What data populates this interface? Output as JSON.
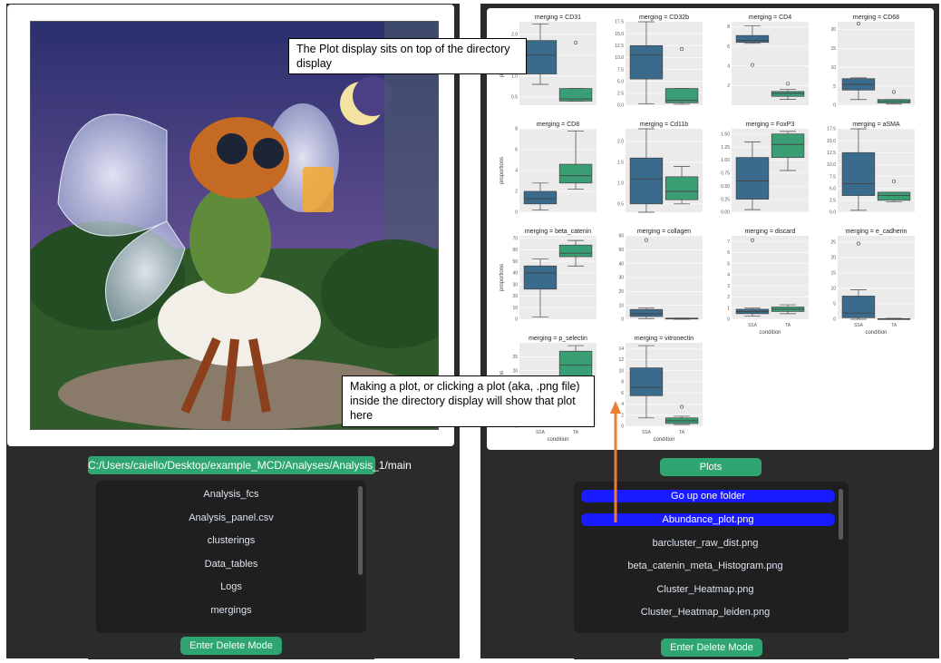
{
  "left": {
    "path_button": "C:/Users/caiello/Desktop/example_MCD/Analyses/Analysis_1/main",
    "files": [
      "Analysis_fcs",
      "Analysis_panel.csv",
      "clusterings",
      "Data_tables",
      "Logs",
      "mergings"
    ],
    "delete_button": "Enter Delete Mode"
  },
  "right": {
    "plots_button": "Plots",
    "files": [
      "Go up one folder",
      "Abundance_plot.png",
      "barcluster_raw_dist.png",
      "beta_catenin_meta_Histogram.png",
      "Cluster_Heatmap.png",
      "Cluster_Heatmap_leiden.png"
    ],
    "highlighted": [
      "Go up one folder",
      "Abundance_plot.png"
    ],
    "delete_button": "Enter Delete Mode"
  },
  "callouts": {
    "top": "The Plot display sits on top of the directory display",
    "bottom": "Making a plot, or clicking a plot (aka, .png file) inside the directory display will show that plot here"
  },
  "colors": {
    "green": "#2fa572",
    "ssa": "#3a6b8c",
    "ta": "#3a9e74",
    "highlight": "#1a1aff",
    "arrow": "#ed7d31"
  },
  "chart_data": {
    "type": "box",
    "x_label": "condition",
    "y_label": "proportions",
    "categories": [
      "SSA",
      "TA"
    ],
    "facet_title_prefix": "merging = ",
    "facets": [
      {
        "name": "CD31",
        "yticks": [
          "0.5",
          "1.0",
          "1.5",
          "2.0"
        ],
        "ymin": 0.3,
        "ymax": 2.3,
        "boxes": [
          {
            "q1": 1.05,
            "med": 1.5,
            "q3": 1.85,
            "lo": 0.8,
            "hi": 2.25,
            "out": []
          },
          {
            "q1": 0.4,
            "med": 0.45,
            "q3": 0.7,
            "lo": 0.4,
            "hi": 0.7,
            "out": [
              1.8
            ]
          }
        ]
      },
      {
        "name": "CD32b",
        "yticks": [
          "0.0",
          "2.5",
          "5.0",
          "7.5",
          "10.0",
          "12.5",
          "15.0",
          "17.5"
        ],
        "ymin": 0,
        "ymax": 17.5,
        "boxes": [
          {
            "q1": 5.5,
            "med": 10.5,
            "q3": 12.5,
            "lo": 0.3,
            "hi": 17.5,
            "out": []
          },
          {
            "q1": 0.5,
            "med": 1.0,
            "q3": 3.5,
            "lo": 0.2,
            "hi": 3.5,
            "out": [
              11.8
            ]
          }
        ]
      },
      {
        "name": "CD4",
        "yticks": [
          "2",
          "4",
          "6",
          "8"
        ],
        "ymin": 0,
        "ymax": 8.5,
        "boxes": [
          {
            "q1": 6.4,
            "med": 6.6,
            "q3": 7.1,
            "lo": 6.3,
            "hi": 8.1,
            "out": [
              4.1
            ]
          },
          {
            "q1": 0.9,
            "med": 1.2,
            "q3": 1.4,
            "lo": 0.6,
            "hi": 1.6,
            "out": [
              2.2
            ]
          }
        ]
      },
      {
        "name": "CD68",
        "yticks": [
          "0",
          "5",
          "10",
          "15",
          "20"
        ],
        "ymin": 0,
        "ymax": 22,
        "boxes": [
          {
            "q1": 4.0,
            "med": 5.5,
            "q3": 7.0,
            "lo": 1.5,
            "hi": 7.2,
            "out": [
              21.5
            ]
          },
          {
            "q1": 0.6,
            "med": 1.0,
            "q3": 1.5,
            "lo": 0.3,
            "hi": 1.5,
            "out": [
              3.5
            ]
          }
        ]
      },
      {
        "name": "CD8",
        "yticks": [
          "0",
          "2",
          "4",
          "6",
          "8"
        ],
        "ymin": 0,
        "ymax": 8,
        "boxes": [
          {
            "q1": 0.8,
            "med": 1.3,
            "q3": 2.0,
            "lo": 0.2,
            "hi": 2.8,
            "out": []
          },
          {
            "q1": 2.8,
            "med": 3.5,
            "q3": 4.6,
            "lo": 2.2,
            "hi": 7.8,
            "out": []
          }
        ]
      },
      {
        "name": "Cd11b",
        "yticks": [
          "0.5",
          "1.0",
          "1.5",
          "2.0"
        ],
        "ymin": 0.3,
        "ymax": 2.3,
        "boxes": [
          {
            "q1": 0.5,
            "med": 1.1,
            "q3": 1.6,
            "lo": 0.3,
            "hi": 2.3,
            "out": []
          },
          {
            "q1": 0.6,
            "med": 0.8,
            "q3": 1.15,
            "lo": 0.5,
            "hi": 1.4,
            "out": []
          }
        ]
      },
      {
        "name": "FoxP3",
        "yticks": [
          "0.00",
          "0.25",
          "0.50",
          "0.75",
          "1.00",
          "1.25",
          "1.50"
        ],
        "ymin": 0,
        "ymax": 1.6,
        "boxes": [
          {
            "q1": 0.25,
            "med": 0.6,
            "q3": 1.05,
            "lo": 0.05,
            "hi": 1.35,
            "out": []
          },
          {
            "q1": 1.05,
            "med": 1.3,
            "q3": 1.5,
            "lo": 0.8,
            "hi": 1.55,
            "out": []
          }
        ]
      },
      {
        "name": "aSMA",
        "yticks": [
          "0.0",
          "2.5",
          "5.0",
          "7.5",
          "10.0",
          "12.5",
          "15.0",
          "17.5"
        ],
        "ymin": 0,
        "ymax": 17.5,
        "boxes": [
          {
            "q1": 3.5,
            "med": 6.0,
            "q3": 12.5,
            "lo": 0.4,
            "hi": 17.5,
            "out": []
          },
          {
            "q1": 2.5,
            "med": 3.5,
            "q3": 4.2,
            "lo": 2.2,
            "hi": 4.2,
            "out": [
              6.5
            ]
          }
        ]
      },
      {
        "name": "beta_catenin",
        "yticks": [
          "0",
          "10",
          "20",
          "30",
          "40",
          "50",
          "60",
          "70"
        ],
        "ymin": 0,
        "ymax": 72,
        "boxes": [
          {
            "q1": 26,
            "med": 40,
            "q3": 46,
            "lo": 2,
            "hi": 52,
            "out": []
          },
          {
            "q1": 54,
            "med": 57,
            "q3": 64,
            "lo": 46,
            "hi": 68,
            "out": []
          }
        ]
      },
      {
        "name": "collagen",
        "yticks": [
          "0",
          "10",
          "20",
          "30",
          "40",
          "50",
          "60"
        ],
        "ymin": 0,
        "ymax": 60,
        "boxes": [
          {
            "q1": 2,
            "med": 4,
            "q3": 7,
            "lo": 0.5,
            "hi": 8,
            "out": [
              57
            ]
          },
          {
            "q1": 0.2,
            "med": 0.5,
            "q3": 0.8,
            "lo": 0,
            "hi": 0.8,
            "out": []
          }
        ]
      },
      {
        "name": "discard",
        "yticks": [
          "0",
          "1",
          "2",
          "3",
          "4",
          "5",
          "6",
          "7"
        ],
        "ymin": 0,
        "ymax": 7.5,
        "boxes": [
          {
            "q1": 0.5,
            "med": 0.7,
            "q3": 0.9,
            "lo": 0.3,
            "hi": 1.0,
            "out": [
              7.1
            ]
          },
          {
            "q1": 0.7,
            "med": 0.9,
            "q3": 1.1,
            "lo": 0.5,
            "hi": 1.3,
            "out": []
          }
        ]
      },
      {
        "name": "e_cadherin",
        "yticks": [
          "0",
          "5",
          "10",
          "15",
          "20",
          "25"
        ],
        "ymin": 0,
        "ymax": 27,
        "boxes": [
          {
            "q1": 0.5,
            "med": 2.0,
            "q3": 7.5,
            "lo": 0,
            "hi": 9.5,
            "out": [
              24.5
            ]
          },
          {
            "q1": 0.05,
            "med": 0.1,
            "q3": 0.2,
            "lo": 0,
            "hi": 0.3,
            "out": []
          }
        ]
      },
      {
        "name": "p_selectin",
        "yticks": [
          "0",
          "5",
          "10",
          "15",
          "20",
          "25"
        ],
        "ymin": 0,
        "ymax": 30,
        "boxes": [
          {
            "q1": 2,
            "med": 5,
            "q3": 9,
            "lo": 0,
            "hi": 14,
            "out": []
          },
          {
            "q1": 16,
            "med": 22,
            "q3": 27,
            "lo": 10,
            "hi": 29,
            "out": []
          }
        ]
      },
      {
        "name": "vitronectin",
        "yticks": [
          "0",
          "2",
          "4",
          "6",
          "8",
          "10",
          "12",
          "14"
        ],
        "ymin": 0,
        "ymax": 15,
        "boxes": [
          {
            "q1": 5.5,
            "med": 7.0,
            "q3": 10.5,
            "lo": 1.5,
            "hi": 14.5,
            "out": []
          },
          {
            "q1": 0.5,
            "med": 1.0,
            "q3": 1.5,
            "lo": 0.3,
            "hi": 1.8,
            "out": [
              3.5
            ]
          }
        ]
      }
    ]
  }
}
